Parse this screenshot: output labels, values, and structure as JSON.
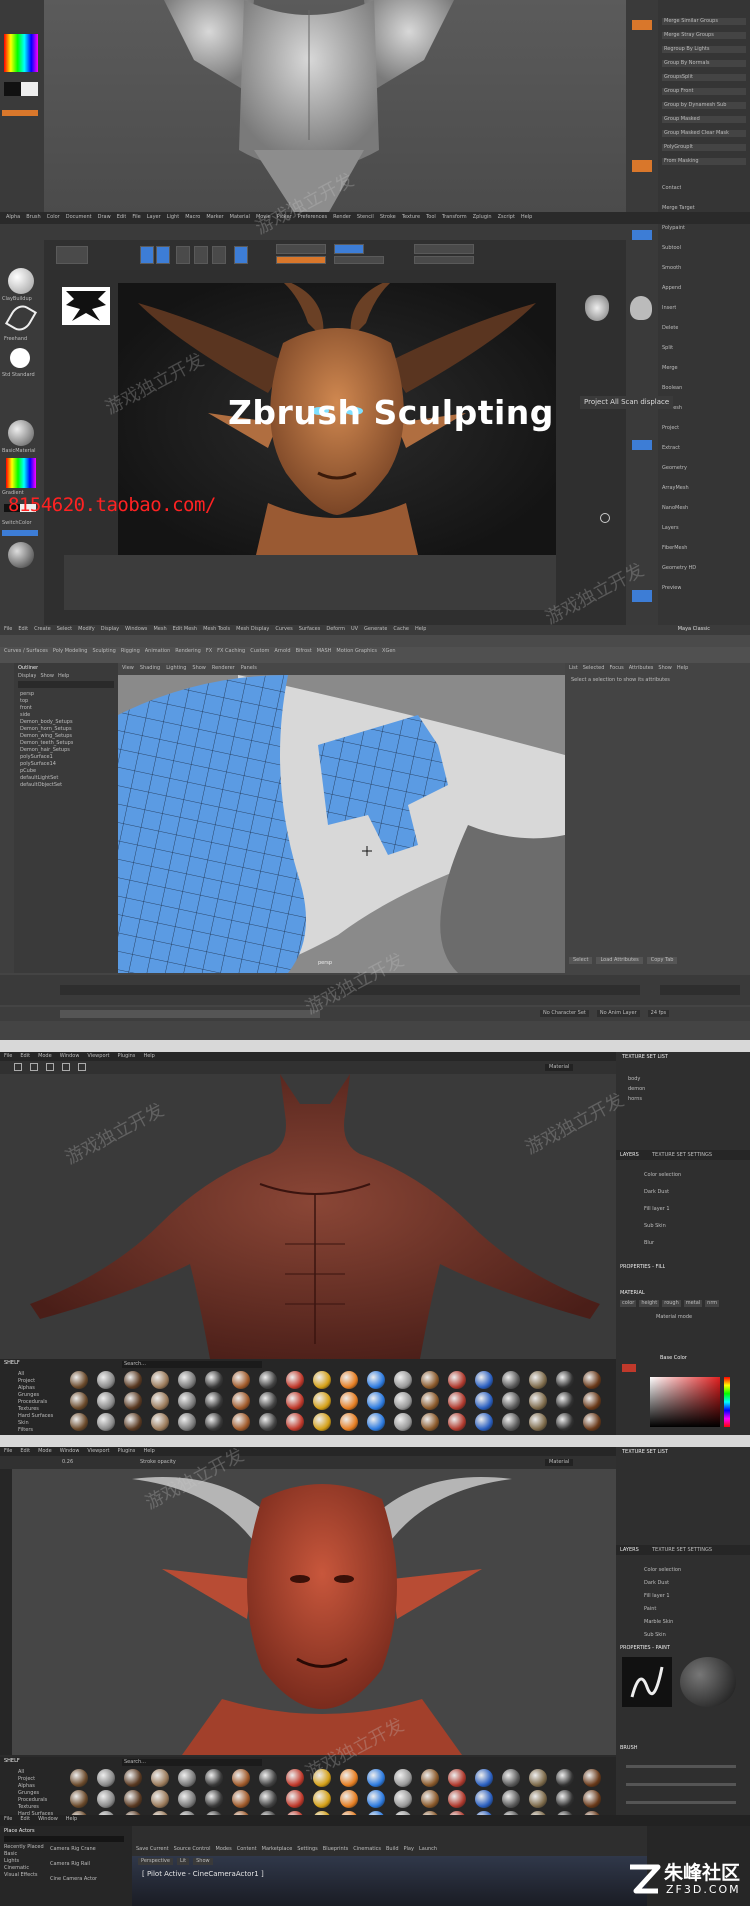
{
  "panel1": {
    "title_overlay": "Zbrush Sculpting",
    "url_overlay": "8154620.taobao.com/",
    "right_top_buttons": [
      "Merge Similar Groups",
      "Merge Stray Groups",
      "Regroup By Lights",
      "Group By Normals",
      "GroupsSplit",
      "Group Front",
      "Group by Dynamesh Sub",
      "Group Masked",
      "Group Masked Clear Mask",
      "PolyGroupIt",
      "From Masking"
    ],
    "right_mid_labels": [
      "Contact",
      "Merge Target",
      "Polypaint",
      "Subtool",
      "Smooth",
      "Append",
      "Insert",
      "Delete",
      "Split",
      "Merge",
      "Boolean",
      "Remesh",
      "Project",
      "Extract",
      "Geometry",
      "ArrayMesh",
      "NanoMesh",
      "Layers",
      "FiberMesh",
      "Geometry HD",
      "Preview"
    ],
    "project_note": "Project All Scan displace",
    "left_labels": [
      "ClayBuildup",
      "Freehand",
      "Std Standard",
      "BasicMaterial",
      "Gradient",
      "SwitchColor"
    ],
    "menu_items": [
      "Alpha",
      "Brush",
      "Color",
      "Document",
      "Draw",
      "Edit",
      "File",
      "Layer",
      "Light",
      "Macro",
      "Marker",
      "Material",
      "Movie",
      "Picker",
      "Preferences",
      "Render",
      "Stencil",
      "Stroke",
      "Texture",
      "Tool",
      "Transform",
      "Zplugin",
      "Zscript",
      "Help"
    ]
  },
  "panel2": {
    "menu_items": [
      "File",
      "Edit",
      "Create",
      "Select",
      "Modify",
      "Display",
      "Windows",
      "Mesh",
      "Edit Mesh",
      "Mesh Tools",
      "Mesh Display",
      "Curves",
      "Surfaces",
      "Deform",
      "UV",
      "Generate",
      "Cache",
      "Help"
    ],
    "workspace": "Maya Classic",
    "tabs": [
      "Curves / Surfaces",
      "Poly Modeling",
      "Sculpting",
      "Rigging",
      "Animation",
      "Rendering",
      "FX",
      "FX Caching",
      "Custom",
      "Arnold",
      "Bifrost",
      "MASH",
      "Motion Graphics",
      "XGen"
    ],
    "outliner_title": "Outliner",
    "outliner_menu": [
      "Display",
      "Show",
      "Help"
    ],
    "outliner_items": [
      "persp",
      "top",
      "front",
      "side",
      "Demon_body_Setups",
      "Demon_horn_Setups",
      "Demon_wing_Setups",
      "Demon_teeth_Setups",
      "Demon_hair_Setups",
      "polySurface1",
      "polySurface14",
      "pCube",
      "defaultLightSet",
      "defaultObjectSet"
    ],
    "viewport_menu": [
      "View",
      "Shading",
      "Lighting",
      "Show",
      "Renderer",
      "Panels"
    ],
    "attr_menu": [
      "List",
      "Selected",
      "Focus",
      "Attributes",
      "Show",
      "Help"
    ],
    "attr_note": "Select a selection to show its attributes",
    "hud_label": "persp",
    "bottom_buttons": [
      "Select",
      "Load Attributes",
      "Copy Tab"
    ],
    "range_labels": [
      "No Character Set",
      "No Anim Layer",
      "24 fps"
    ]
  },
  "panel3": {
    "menu_items": [
      "File",
      "Edit",
      "Mode",
      "Window",
      "Viewport",
      "Plugins",
      "Help"
    ],
    "viewport_mode": "Material",
    "texture_set_list": "TEXTURE SET LIST",
    "texture_sets": [
      "body",
      "demon",
      "horns"
    ],
    "layers_tab": "LAYERS",
    "texture_set_settings_tab": "TEXTURE SET SETTINGS",
    "layer_items": [
      "Color selection",
      "Dark Dust",
      "Fill layer 1",
      "Sub Skin",
      "Blur"
    ],
    "properties_title": "PROPERTIES - FILL",
    "material_title": "MATERIAL",
    "material_channels": [
      "color",
      "height",
      "rough",
      "metal",
      "nrm"
    ],
    "material_mode": "Material mode",
    "base_color_label": "Base Color",
    "shelf_title": "SHELF",
    "shelf_categories": [
      "All",
      "Project",
      "Alphas",
      "Grunges",
      "Procedurals",
      "Textures",
      "Hard Surfaces",
      "Skin",
      "Filters"
    ],
    "shelf_search": "Search..."
  },
  "panel4": {
    "menu_items": [
      "File",
      "Edit",
      "Mode",
      "Window",
      "Viewport",
      "Plugins",
      "Help"
    ],
    "viewport_mode": "Material",
    "stroke_opacity": "Stroke opacity",
    "size_value": "0.26",
    "texture_set_list": "TEXTURE SET LIST",
    "layers_tab": "LAYERS",
    "texture_set_settings_tab": "TEXTURE SET SETTINGS",
    "layer_items": [
      "Color selection",
      "Dark Dust",
      "Fill layer 1",
      "Paint",
      "Marble Skin",
      "Sub Skin"
    ],
    "properties_title": "PROPERTIES - PAINT",
    "brush_label": "BRUSH",
    "shelf_title": "SHELF",
    "shelf_categories": [
      "All",
      "Project",
      "Alphas",
      "Grunges",
      "Procedurals",
      "Textures",
      "Hard Surfaces",
      "Skin",
      "Filters"
    ],
    "shelf_search": "Search..."
  },
  "panel5": {
    "menu_items": [
      "File",
      "Edit",
      "Window",
      "Help"
    ],
    "place_actors": "Place Actors",
    "left_items": [
      "Recently Placed",
      "Basic",
      "Lights",
      "Cinematic",
      "Visual Effects"
    ],
    "list_items": [
      "Camera Rig Crane",
      "Camera Rig Rail",
      "Cine Camera Actor"
    ],
    "toolbar_items": [
      "Save Current",
      "Source Control",
      "Modes",
      "Content",
      "Marketplace",
      "Settings",
      "Blueprints",
      "Cinematics",
      "Build",
      "Play",
      "Launch"
    ],
    "viewport_label": "[ Pilot Active - CineCameraActor1 ]",
    "perspective": "Perspective",
    "lit": "Lit",
    "show": "Show"
  },
  "watermark_text": "游戏独立开发",
  "logo": {
    "name": "朱峰社区",
    "domain": "ZF3D.COM"
  },
  "colors": {
    "zbrush_orange": "#d9772b",
    "zbrush_blue": "#3d7dd6",
    "maya_uv_blue": "#5b9be3",
    "demon_red": "#7a3a2f",
    "demon_skin": "#b96a3f",
    "url_red": "#ff2222"
  }
}
